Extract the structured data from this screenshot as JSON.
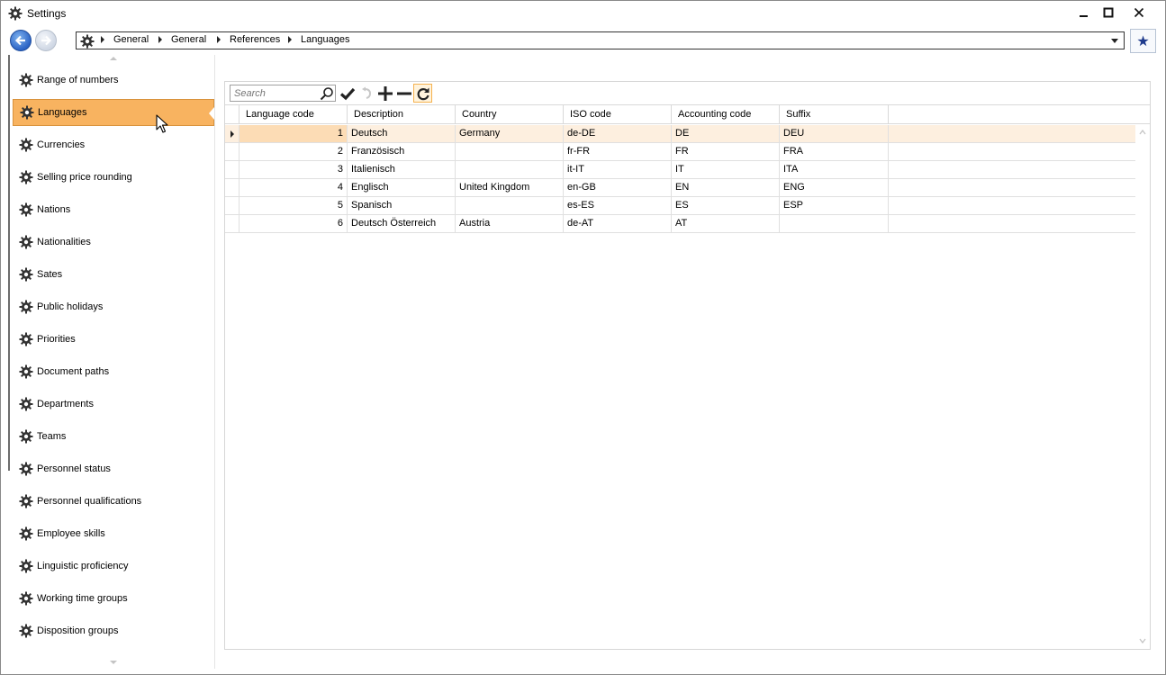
{
  "window": {
    "title": "Settings",
    "minimize_icon": "minimize-icon",
    "maximize_icon": "maximize-icon",
    "close_icon": "close-icon"
  },
  "breadcrumb": [
    "General",
    "General",
    "References",
    "Languages"
  ],
  "search": {
    "placeholder": "Search"
  },
  "sidebar": {
    "items": [
      {
        "label": "Range of numbers"
      },
      {
        "label": "Languages",
        "selected": true
      },
      {
        "label": "Currencies"
      },
      {
        "label": "Selling price rounding"
      },
      {
        "label": "Nations"
      },
      {
        "label": "Nationalities"
      },
      {
        "label": "Sates"
      },
      {
        "label": "Public holidays"
      },
      {
        "label": "Priorities"
      },
      {
        "label": "Document paths"
      },
      {
        "label": "Departments"
      },
      {
        "label": "Teams"
      },
      {
        "label": "Personnel status"
      },
      {
        "label": "Personnel qualifications"
      },
      {
        "label": "Employee skills"
      },
      {
        "label": "Linguistic proficiency"
      },
      {
        "label": "Working time groups"
      },
      {
        "label": "Disposition groups"
      }
    ]
  },
  "grid": {
    "columns": [
      "Language code",
      "Description",
      "Country",
      "ISO code",
      "Accounting code",
      "Suffix"
    ],
    "rows": [
      [
        "1",
        "Deutsch",
        "Germany",
        "de-DE",
        "DE",
        "DEU"
      ],
      [
        "2",
        "Französisch",
        "",
        "fr-FR",
        "FR",
        "FRA"
      ],
      [
        "3",
        "Italienisch",
        "",
        "it-IT",
        "IT",
        "ITA"
      ],
      [
        "4",
        "Englisch",
        "United Kingdom",
        "en-GB",
        "EN",
        "ENG"
      ],
      [
        "5",
        "Spanisch",
        "",
        "es-ES",
        "ES",
        "ESP"
      ],
      [
        "6",
        "Deutsch Österreich",
        "Austria",
        "de-AT",
        "AT",
        ""
      ]
    ]
  },
  "colors": {
    "selected_item": "#f8b360",
    "active_row": "#fdefdf",
    "accent_blue": "#2c64c5"
  }
}
